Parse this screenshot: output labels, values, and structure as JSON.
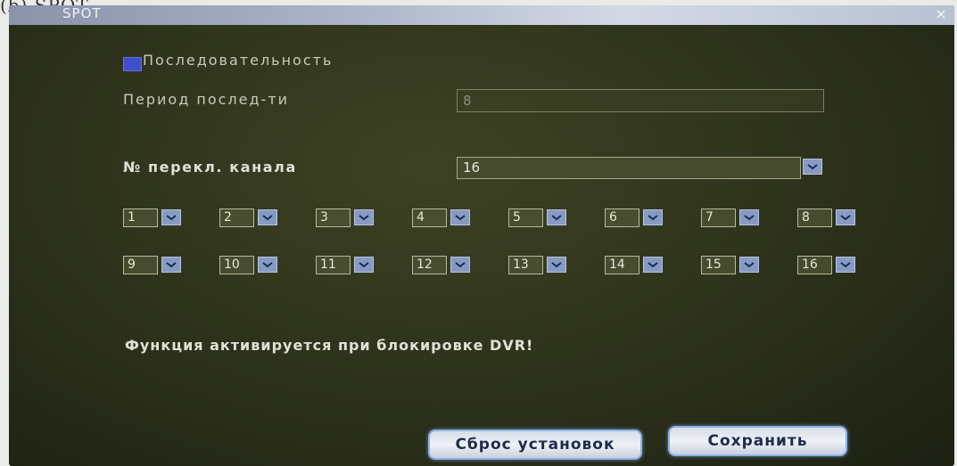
{
  "caption": "(b) SPOT",
  "window": {
    "title": "SPOT",
    "close_glyph": "×"
  },
  "sequence": {
    "checkbox_label": "Последовательность",
    "checked": true
  },
  "period": {
    "label": "Период послед-ти",
    "value": "8"
  },
  "channel_switch": {
    "label": "№ перекл. канала",
    "value": "16"
  },
  "channels": [
    "1",
    "2",
    "3",
    "4",
    "5",
    "6",
    "7",
    "8",
    "9",
    "10",
    "11",
    "12",
    "13",
    "14",
    "15",
    "16"
  ],
  "notice": "Функция активируется при блокировке DVR!",
  "buttons": {
    "reset": "Сброс установок",
    "save": "Сохранить"
  },
  "colors": {
    "accent": "#879bc2",
    "checkbox": "#3d4fcc"
  }
}
